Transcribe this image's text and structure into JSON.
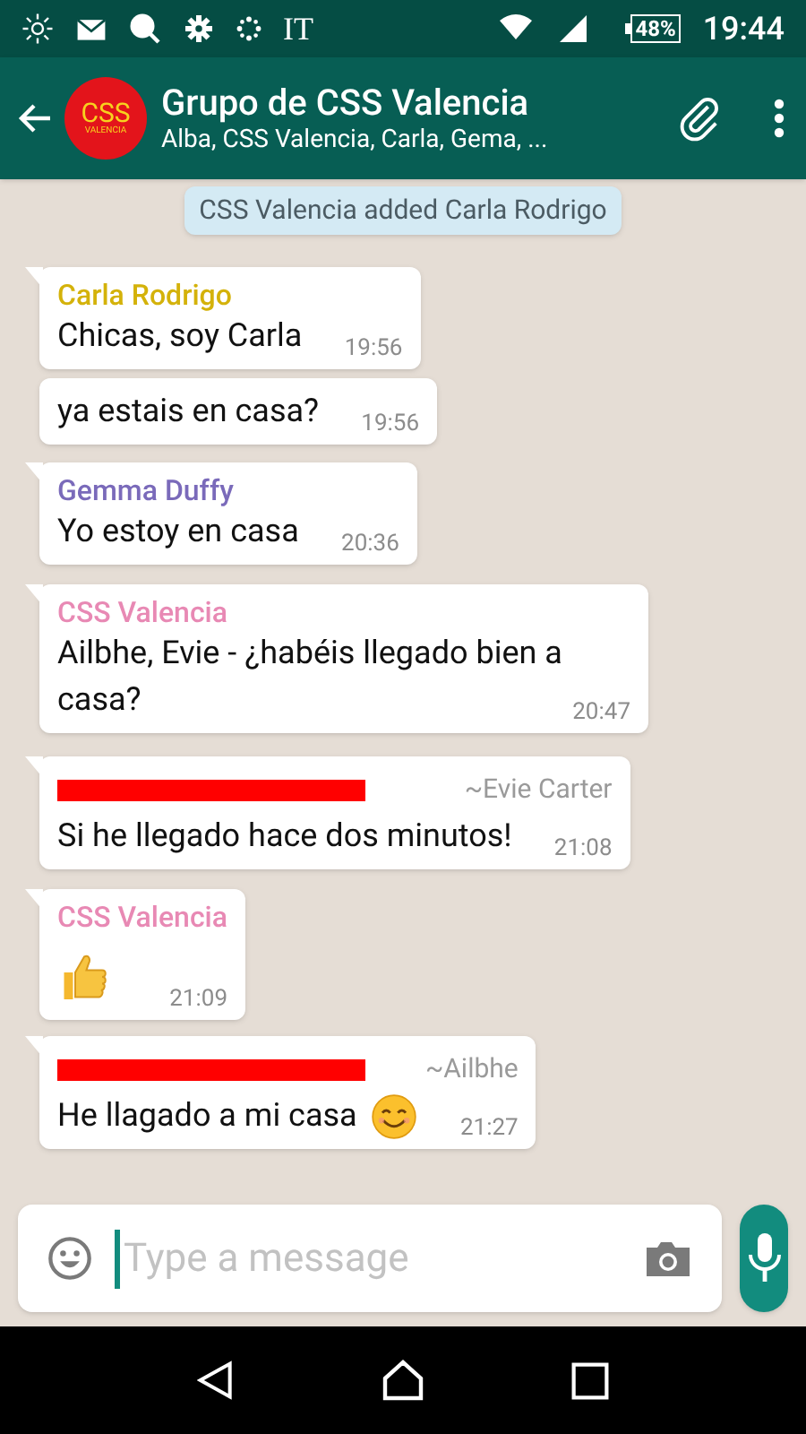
{
  "status_bar": {
    "carrier_text": "IT",
    "battery": "48%",
    "time": "19:44"
  },
  "header": {
    "avatar_text": "CSS",
    "avatar_subtext": "VALENCIA",
    "title": "Grupo de CSS Valencia",
    "subtitle": "Alba, CSS Valencia, Carla, Gema, ..."
  },
  "system_message": "CSS Valencia added Carla Rodrigo",
  "messages": [
    {
      "sender": "Carla Rodrigo",
      "color": "#d4b20a",
      "text": "Chicas, soy Carla",
      "time": "19:56",
      "tail": true
    },
    {
      "text": "ya estais en casa?",
      "time": "19:56",
      "tail": false
    },
    {
      "sender": "Gemma Duffy",
      "color": "#7a6aba",
      "text": "Yo estoy en casa",
      "time": "20:36",
      "tail": true
    },
    {
      "sender": "CSS Valencia",
      "color": "#e889b4",
      "text": "Ailbhe, Evie - ¿habéis llegado bien a casa?",
      "time": "20:47",
      "tail": true
    },
    {
      "redacted": true,
      "author": "~Evie Carter",
      "text": "Si he llegado hace dos minutos!",
      "time": "21:08",
      "tail": true
    },
    {
      "sender": "CSS Valencia",
      "color": "#e889b4",
      "emoji": {
        "kind": "thumbs-up"
      },
      "time": "21:09",
      "tail": true
    },
    {
      "redacted": true,
      "author": "~Ailbhe",
      "text": "He llagado a mi casa",
      "emoji": {
        "kind": "smiling-face"
      },
      "time": "21:27",
      "tail": true
    }
  ],
  "composer": {
    "placeholder": "Type a message"
  }
}
